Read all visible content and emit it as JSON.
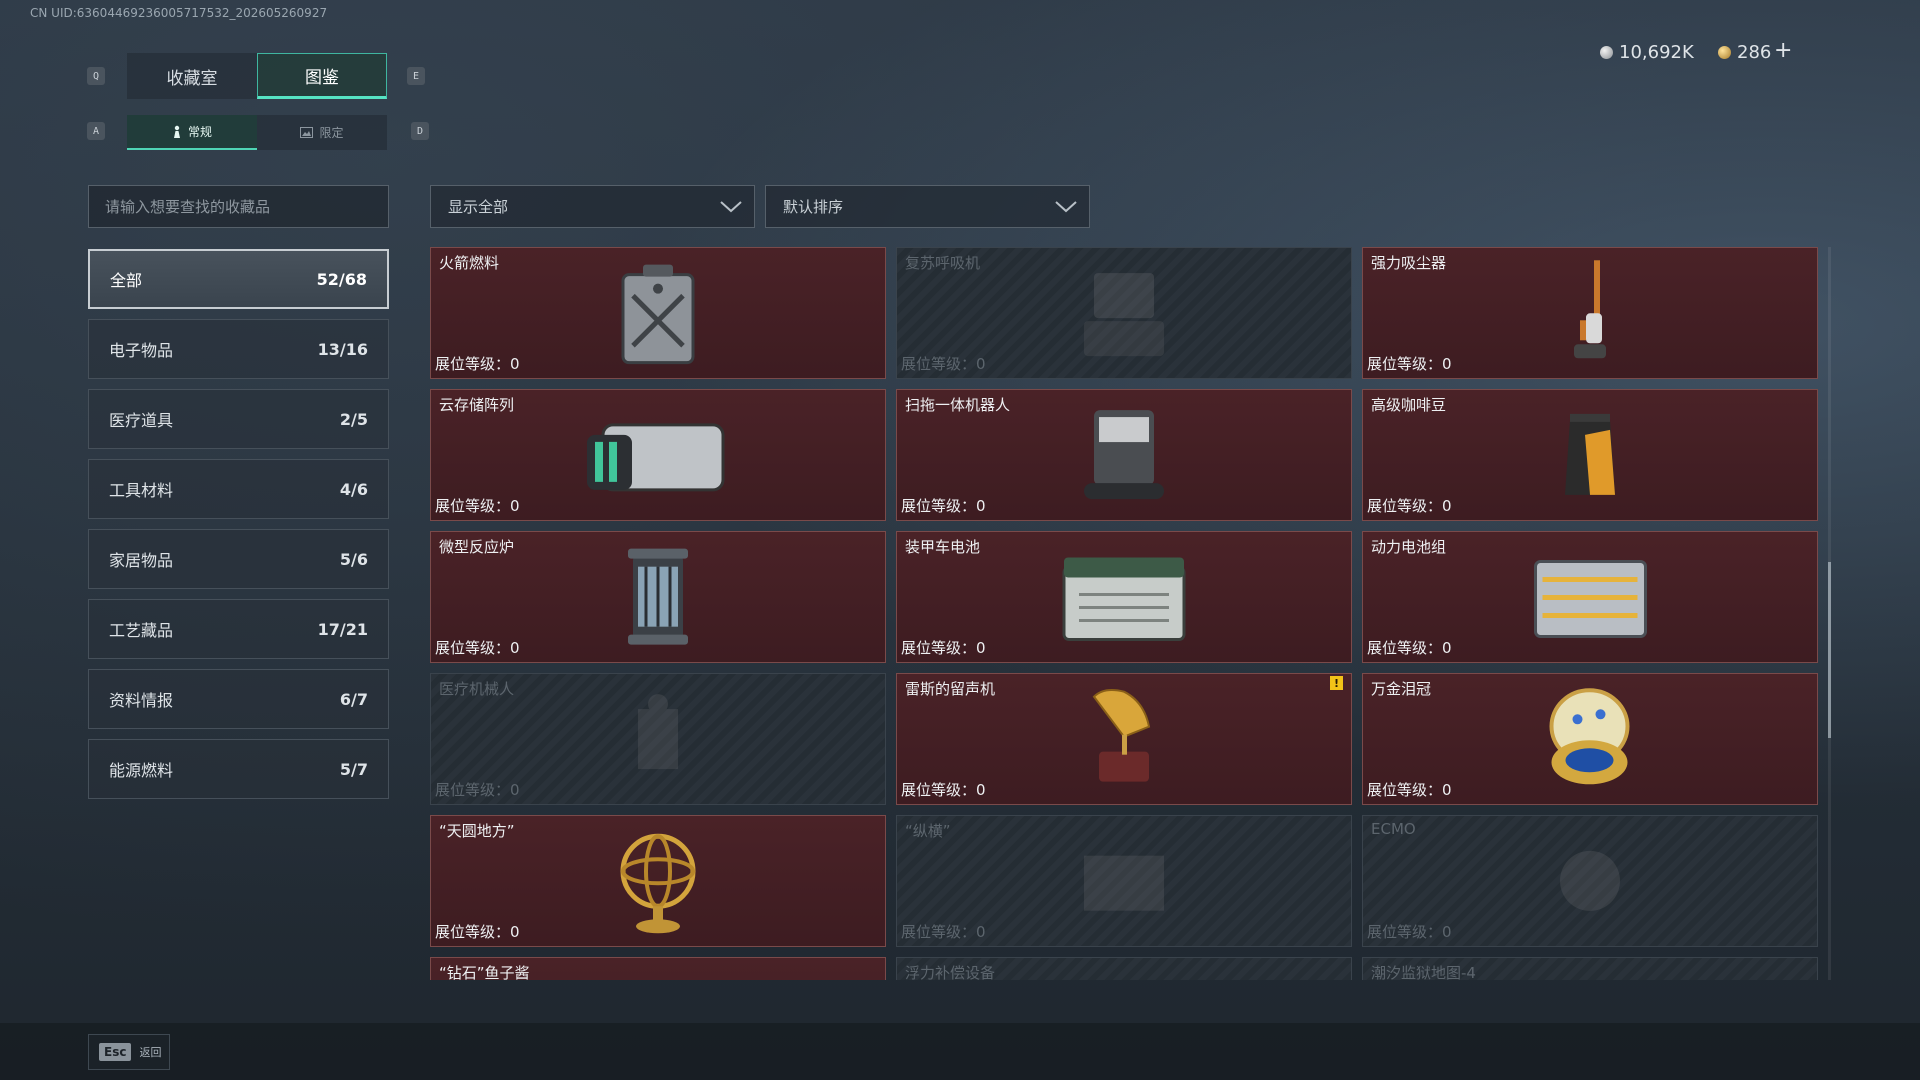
{
  "uid": "CN UID:636044692360057175​32_202605260927",
  "currency": {
    "silver": "10,692K",
    "gold": "286",
    "plus": "+"
  },
  "keys": {
    "prev_tab": "Q",
    "next_tab": "E",
    "prev_sub": "A",
    "next_sub": "D"
  },
  "tabs": [
    {
      "label": "收藏室"
    },
    {
      "label": "图鉴"
    }
  ],
  "subtabs": [
    {
      "label": "常规"
    },
    {
      "label": "限定"
    }
  ],
  "search": {
    "placeholder": "请输入想要查找的收藏品"
  },
  "categories": [
    {
      "label": "全部",
      "count": "52/68"
    },
    {
      "label": "电子物品",
      "count": "13/16"
    },
    {
      "label": "医疗道具",
      "count": "2/5"
    },
    {
      "label": "工具材料",
      "count": "4/6"
    },
    {
      "label": "家居物品",
      "count": "5/6"
    },
    {
      "label": "工艺藏品",
      "count": "17/21"
    },
    {
      "label": "资料情报",
      "count": "6/7"
    },
    {
      "label": "能源燃料",
      "count": "5/7"
    }
  ],
  "filters": {
    "show": "显示全部",
    "sort": "默认排序"
  },
  "items": [
    {
      "name": "火箭燃料",
      "level": "展位等级：0",
      "locked": false,
      "icon": "fuel-canister-icon"
    },
    {
      "name": "复苏呼吸机",
      "level": "展位等级：0",
      "locked": true,
      "icon": "ventilator-icon"
    },
    {
      "name": "强力吸尘器",
      "level": "展位等级：0",
      "locked": false,
      "icon": "vacuum-icon"
    },
    {
      "name": "云存储阵列",
      "level": "展位等级：0",
      "locked": false,
      "icon": "storage-array-icon"
    },
    {
      "name": "扫拖一体机器人",
      "level": "展位等级：0",
      "locked": false,
      "icon": "mop-robot-icon"
    },
    {
      "name": "高级咖啡豆",
      "level": "展位等级：0",
      "locked": false,
      "icon": "coffee-bag-icon"
    },
    {
      "name": "微型反应炉",
      "level": "展位等级：0",
      "locked": false,
      "icon": "reactor-icon"
    },
    {
      "name": "装甲车电池",
      "level": "展位等级：0",
      "locked": false,
      "icon": "battery-icon"
    },
    {
      "name": "动力电池组",
      "level": "展位等级：0",
      "locked": false,
      "icon": "battery-pack-icon"
    },
    {
      "name": "医疗机械人",
      "level": "展位等级：0",
      "locked": true,
      "icon": "medical-robot-icon"
    },
    {
      "name": "雷斯的留声机",
      "level": "展位等级：0",
      "locked": false,
      "icon": "gramophone-icon",
      "badge": "!"
    },
    {
      "name": "万金泪冠",
      "level": "展位等级：0",
      "locked": false,
      "icon": "jeweled-egg-icon"
    },
    {
      "name": "“天圆地方”",
      "level": "展位等级：0",
      "locked": false,
      "icon": "armillary-sphere-icon"
    },
    {
      "name": "“纵横”",
      "level": "展位等级：0",
      "locked": true,
      "icon": "chessboard-icon"
    },
    {
      "name": "ECMO",
      "level": "展位等级：0",
      "locked": true,
      "icon": "ecmo-icon"
    },
    {
      "name": "“钻石”鱼子酱",
      "level": "",
      "locked": false,
      "icon": "caviar-icon"
    },
    {
      "name": "浮力补偿设备",
      "level": "",
      "locked": true,
      "icon": "bcd-icon"
    },
    {
      "name": "潮汐监狱地图-4",
      "level": "",
      "locked": true,
      "icon": "map-icon"
    }
  ],
  "footer": {
    "esc_key": "Esc",
    "back": "返回"
  }
}
